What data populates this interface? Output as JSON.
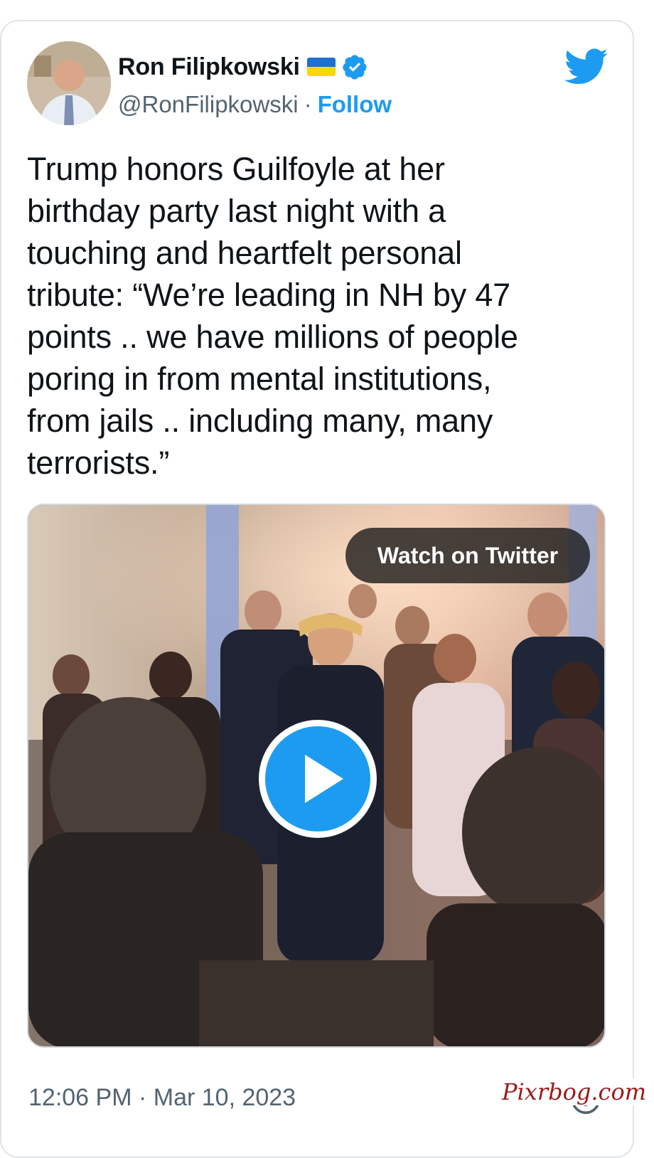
{
  "author": {
    "display_name": "Ron Filipkowski",
    "handle": "@RonFilipkowski",
    "separator": "·",
    "follow_label": "Follow",
    "flag": "ukraine-flag-icon",
    "verified_icon": "verified-badge-icon"
  },
  "brand_icon": "twitter-bird-icon",
  "tweet": {
    "text": "Trump honors Guilfoyle at her\nbirthday party last night with a\ntouching and heartfelt personal\ntribute: “We’re leading in NH by 47\npoints .. we have millions of people\nporing in from mental institutions,\nfrom jails .. including many, many\nterrorists.”",
    "timestamp": "12:06 PM · Mar 10, 2023"
  },
  "media": {
    "watch_label": "Watch on Twitter",
    "play_icon": "play-icon"
  },
  "watermark": "Pixrbog.com",
  "colors": {
    "accent": "#1d9bf0",
    "text": "#0f1419",
    "secondary": "#536471"
  }
}
